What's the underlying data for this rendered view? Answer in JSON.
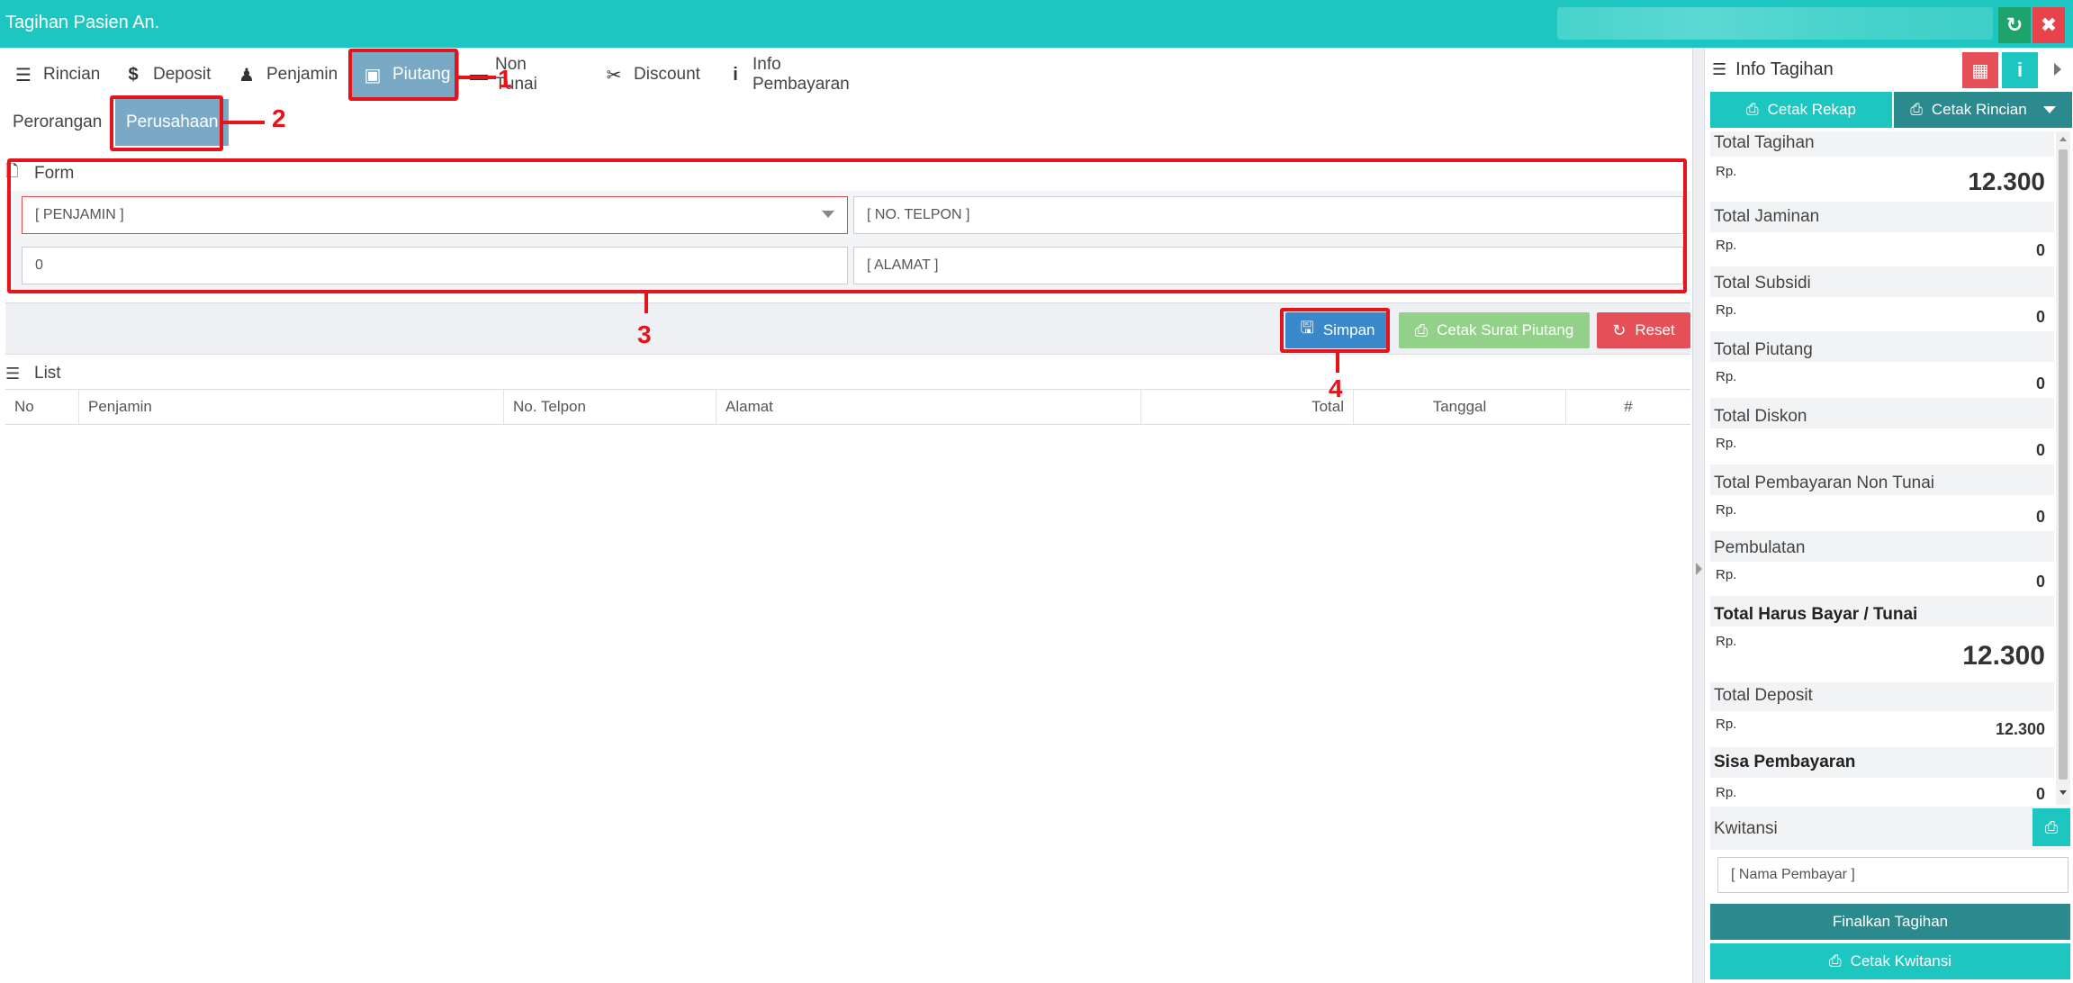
{
  "window": {
    "title": "Tagihan Pasien An."
  },
  "tabs": [
    {
      "label": "Rincian",
      "icon": "list-icon"
    },
    {
      "label": "Deposit",
      "icon": "dollar-icon"
    },
    {
      "label": "Penjamin",
      "icon": "user-secret-icon"
    },
    {
      "label": "Piutang",
      "icon": "money-icon",
      "active": true
    },
    {
      "label": "Non Tunai",
      "icon": "credit-card-icon"
    },
    {
      "label": "Discount",
      "icon": "unlink-icon"
    },
    {
      "label": "Info Pembayaran",
      "icon": "info-icon"
    }
  ],
  "subtabs": [
    {
      "label": "Perorangan"
    },
    {
      "label": "Perusahaan",
      "active": true
    }
  ],
  "annotations": [
    "1",
    "2",
    "3",
    "4"
  ],
  "form": {
    "title": "Form",
    "penjamin": "[ PENJAMIN ]",
    "no_telpon_placeholder": "[ NO. TELPON ]",
    "amount": "0",
    "alamat_placeholder": "[ ALAMAT ]"
  },
  "actions": {
    "simpan": "Simpan",
    "cetak_surat": "Cetak Surat Piutang",
    "reset": "Reset"
  },
  "list": {
    "title": "List",
    "columns": [
      "No",
      "Penjamin",
      "No. Telpon",
      "Alamat",
      "Total",
      "Tanggal",
      "#"
    ],
    "rows": []
  },
  "info": {
    "title": "Info Tagihan",
    "cetak_rekap": "Cetak Rekap",
    "cetak_rincian": "Cetak Rincian",
    "currency": "Rp.",
    "items": [
      {
        "label": "Total Tagihan",
        "value": "12.300"
      },
      {
        "label": "Total Jaminan",
        "value": "0"
      },
      {
        "label": "Total Subsidi",
        "value": "0"
      },
      {
        "label": "Total Piutang",
        "value": "0"
      },
      {
        "label": "Total Diskon",
        "value": "0"
      },
      {
        "label": "Total Pembayaran Non Tunai",
        "value": "0"
      },
      {
        "label": "Pembulatan",
        "value": "0"
      },
      {
        "label": "Total Harus Bayar / Tunai",
        "value": "12.300"
      },
      {
        "label": "Total Deposit",
        "value": "12.300"
      },
      {
        "label": "Sisa Pembayaran",
        "value": "0"
      }
    ],
    "kwitansi_label": "Kwitansi",
    "nama_pembayar_placeholder": "[ Nama Pembayar ]",
    "finalkan": "Finalkan Tagihan",
    "cetak_kwitansi": "Cetak Kwitansi"
  },
  "colors": {
    "teal": "#1dc6c0",
    "dark_teal": "#2a8a8d",
    "active_tab": "#79a9c4",
    "primary": "#3a88c9",
    "success_light": "#93d18a",
    "danger": "#e54f57",
    "annotation_red": "#e5141a"
  }
}
